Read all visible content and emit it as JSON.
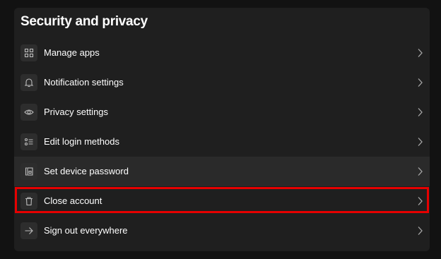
{
  "section": {
    "title": "Security and privacy"
  },
  "items": [
    {
      "label": "Manage apps",
      "icon": "grid-icon"
    },
    {
      "label": "Notification settings",
      "icon": "bell-icon"
    },
    {
      "label": "Privacy settings",
      "icon": "eye-icon"
    },
    {
      "label": "Edit login methods",
      "icon": "list-icon"
    },
    {
      "label": "Set device password",
      "icon": "device-lock-icon"
    },
    {
      "label": "Close account",
      "icon": "trash-icon"
    },
    {
      "label": "Sign out everywhere",
      "icon": "arrow-right-icon"
    }
  ],
  "colors": {
    "background": "#121212",
    "card": "#1f1f1f",
    "hover_row": "#2a2a2a",
    "highlight": "#e60000"
  }
}
